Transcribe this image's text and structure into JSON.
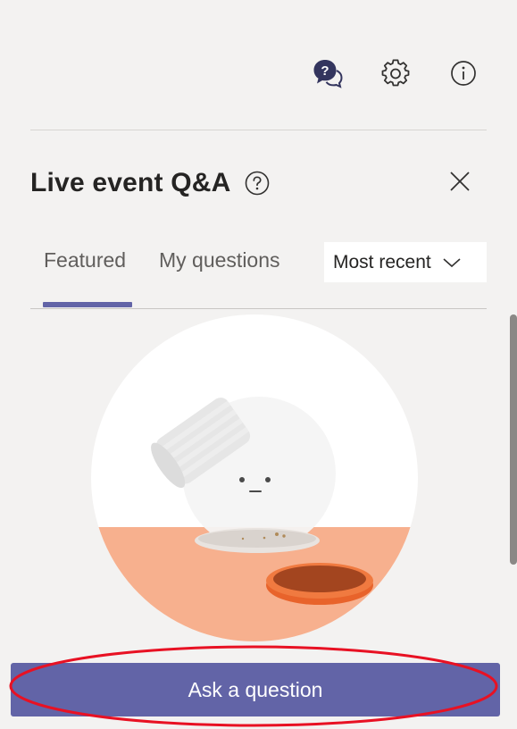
{
  "header": {
    "title": "Live event Q&A",
    "icons": [
      "qa-chat-icon",
      "gear-icon",
      "info-icon"
    ],
    "help_icon": "help-circle-icon",
    "close_icon": "close-icon"
  },
  "tabs": [
    {
      "label": "Featured",
      "selected": true
    },
    {
      "label": "My questions",
      "selected": false
    }
  ],
  "sort": {
    "selected": "Most recent",
    "icon": "chevron-down-icon"
  },
  "empty_state": {
    "illustration": "empty-jar-illustration"
  },
  "ask_button": {
    "label": "Ask a question"
  },
  "colors": {
    "accent": "#6264a7",
    "background": "#f3f2f1",
    "highlight": "#e81123",
    "illustration_orange": "#f7b08e",
    "lid_orange": "#e8632b"
  }
}
